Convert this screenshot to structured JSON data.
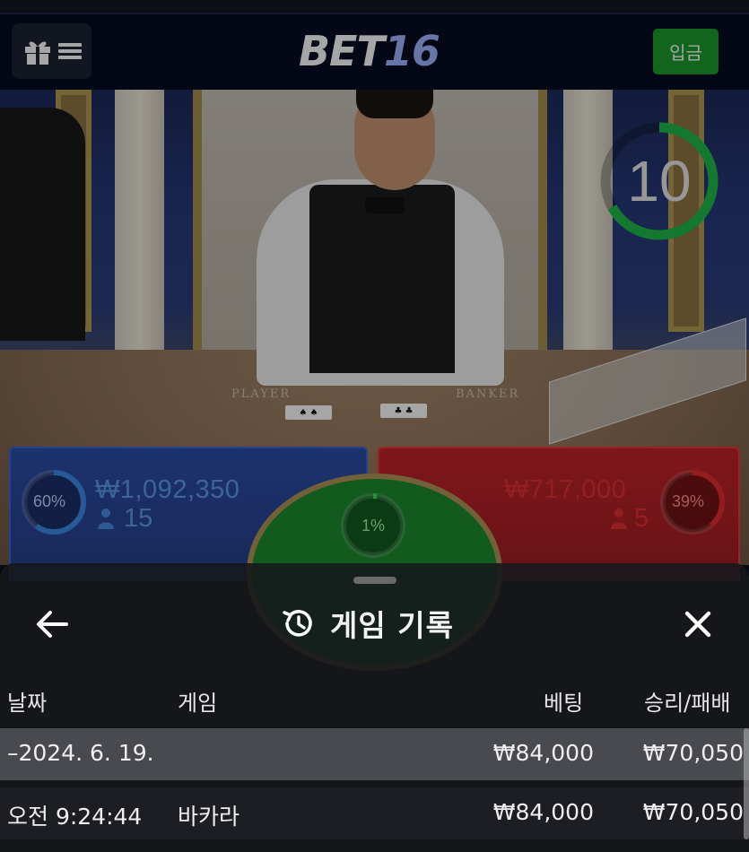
{
  "header": {
    "logo_main": "BET",
    "logo_num": "16",
    "deposit_label": "입금"
  },
  "scene": {
    "felt_player": "PLAYER",
    "felt_banker": "BANKER",
    "timer": "10",
    "timer_progress": 0.67
  },
  "betting": {
    "player": {
      "percent": "60%",
      "percent_value": 0.6,
      "amount": "₩1,092,350",
      "count": "15",
      "color": "#3a7bd5"
    },
    "banker": {
      "percent": "39%",
      "percent_value": 0.39,
      "amount": "₩717,000",
      "count": "5",
      "color": "#e32b2b"
    },
    "tie": {
      "percent": "1%",
      "percent_value": 0.01,
      "color": "#2fbf4a"
    }
  },
  "history_sheet": {
    "title": "게임 기록",
    "columns": {
      "date": "날짜",
      "game": "게임",
      "bet": "베팅",
      "result": "승리/패배"
    },
    "date_row": {
      "date": "–2024. 6. 19.",
      "bet": "₩84,000",
      "result": "₩70,050"
    },
    "rows": [
      {
        "time": "오전 9:24:44",
        "game": "바카라",
        "bet": "₩84,000",
        "result": "₩70,050"
      }
    ]
  }
}
